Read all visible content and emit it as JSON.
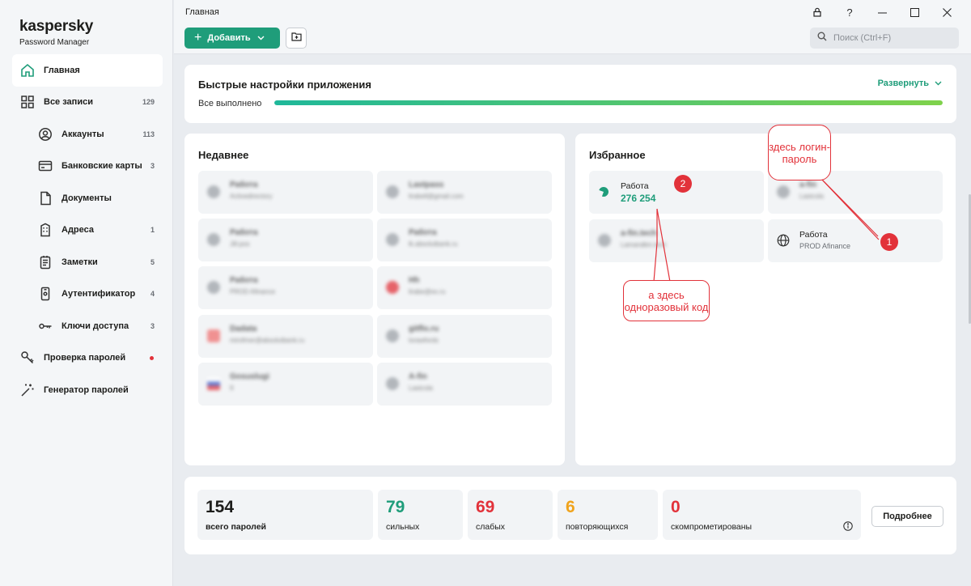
{
  "app": {
    "logo_word": "kaspersky",
    "logo_sub": "Password Manager",
    "window_title": "Главная"
  },
  "sidebar": {
    "items": [
      {
        "label": "Главная",
        "icon": "home-icon",
        "active": true
      },
      {
        "label": "Все записи",
        "icon": "grid-icon",
        "count": "129"
      },
      {
        "label": "Аккаунты",
        "icon": "user-icon",
        "count": "113",
        "sub": true
      },
      {
        "label": "Банковские карты",
        "icon": "card-icon",
        "count": "3",
        "sub": true
      },
      {
        "label": "Документы",
        "icon": "document-icon",
        "sub": true
      },
      {
        "label": "Адреса",
        "icon": "building-icon",
        "count": "1",
        "sub": true
      },
      {
        "label": "Заметки",
        "icon": "note-icon",
        "count": "5",
        "sub": true
      },
      {
        "label": "Аутентификатор",
        "icon": "authenticator-icon",
        "count": "4",
        "sub": true
      },
      {
        "label": "Ключи доступа",
        "icon": "key-icon",
        "count": "3",
        "sub": true
      },
      {
        "label": "Проверка паролей",
        "icon": "password-check-icon",
        "alert": true
      },
      {
        "label": "Генератор паролей",
        "icon": "magic-wand-icon"
      }
    ]
  },
  "toolbar": {
    "add_label": "Добавить",
    "search_placeholder": "Поиск (Ctrl+F)"
  },
  "quick_settings": {
    "title": "Быстрые настройки приложения",
    "status": "Все выполнено",
    "progress": 1.0,
    "expand_label": "Развернуть"
  },
  "recent": {
    "title": "Недавнее",
    "items": [
      {
        "name": "Работа",
        "sub": "Activedirectory"
      },
      {
        "name": "Lastpass",
        "sub": "lirabell@gmail.com"
      },
      {
        "name": "Работа",
        "sub": "Jill.pos"
      },
      {
        "name": "Работа",
        "sub": "lk.absolutbank.ru"
      },
      {
        "name": "Работа",
        "sub": "PROD Afinance"
      },
      {
        "name": "Hh",
        "sub": "lirabe@ex.ru"
      },
      {
        "name": "Dadata",
        "sub": "mirofmer@absolutbank.ru"
      },
      {
        "name": "gitflo.ru",
        "sub": "lorawfords"
      },
      {
        "name": "Gosuslugi",
        "sub": "9"
      },
      {
        "name": "A-fin",
        "sub": "Lastcola"
      }
    ]
  },
  "favorites": {
    "title": "Избранное",
    "items": [
      {
        "name": "Работа",
        "code": "276 254"
      },
      {
        "name": "a-fin",
        "sub": "Lastcola"
      },
      {
        "name": "a-fin.tech",
        "sub": "Lamandkin.tech"
      },
      {
        "name": "Работа",
        "sub": "PROD Afinance"
      }
    ]
  },
  "stats": [
    {
      "value": "154",
      "label": "всего паролей",
      "color": "#1d1d1b"
    },
    {
      "value": "79",
      "label": "сильных",
      "color": "#1f9d7a"
    },
    {
      "value": "69",
      "label": "слабых",
      "color": "#e2323a"
    },
    {
      "value": "6",
      "label": "повторяющихся",
      "color": "#f0a31c"
    },
    {
      "value": "0",
      "label": "скомпрометированы",
      "color": "#e2323a"
    }
  ],
  "stats_more_label": "Подробнее",
  "annotations": {
    "bubble1": "здесь логин-пароль",
    "bubble2": "а здесь одноразовый код",
    "badge1": "1",
    "badge2": "2"
  },
  "colors": {
    "accent": "#1f9d7a",
    "danger": "#e2323a",
    "warning": "#f0a31c"
  }
}
